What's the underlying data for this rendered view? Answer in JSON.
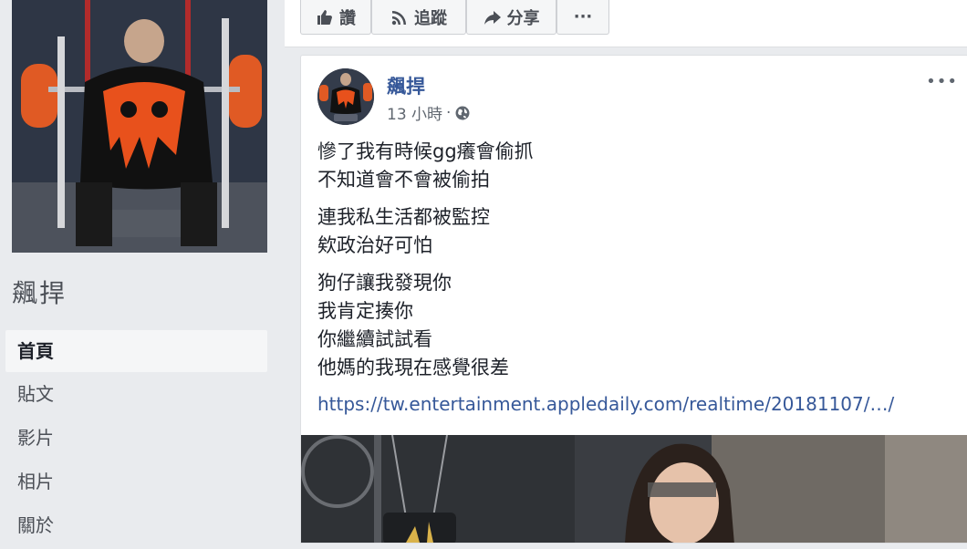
{
  "page": {
    "name": "飆捍"
  },
  "sidebar": {
    "items": [
      {
        "label": "首頁"
      },
      {
        "label": "貼文"
      },
      {
        "label": "影片"
      },
      {
        "label": "相片"
      },
      {
        "label": "關於"
      }
    ]
  },
  "action_bar": {
    "like_label": "讚",
    "follow_label": "追蹤",
    "share_label": "分享",
    "more_label": "···"
  },
  "post": {
    "author": "飆捍",
    "time": "13 小時",
    "separator": "·",
    "more_label": "•••",
    "paragraphs": [
      {
        "lines": [
          "慘了我有時候gg癢會偷抓",
          "不知道會不會被偷拍"
        ]
      },
      {
        "lines": [
          "連我私生活都被監控",
          "欸政治好可怕"
        ]
      },
      {
        "lines": [
          "狗仔讓我發現你",
          "我肯定揍你",
          "你繼續試試看",
          "他媽的我現在感覺很差"
        ]
      }
    ],
    "link": "https://tw.entertainment.appledaily.com/realtime/20181107/…/"
  },
  "colors": {
    "link": "#365899",
    "text": "#1d2129",
    "muted": "#606770",
    "background": "#e9ebee"
  },
  "icons": {
    "like": "thumbs-up-icon",
    "follow": "rss-icon",
    "share": "share-arrow-icon",
    "privacy": "globe-icon"
  }
}
